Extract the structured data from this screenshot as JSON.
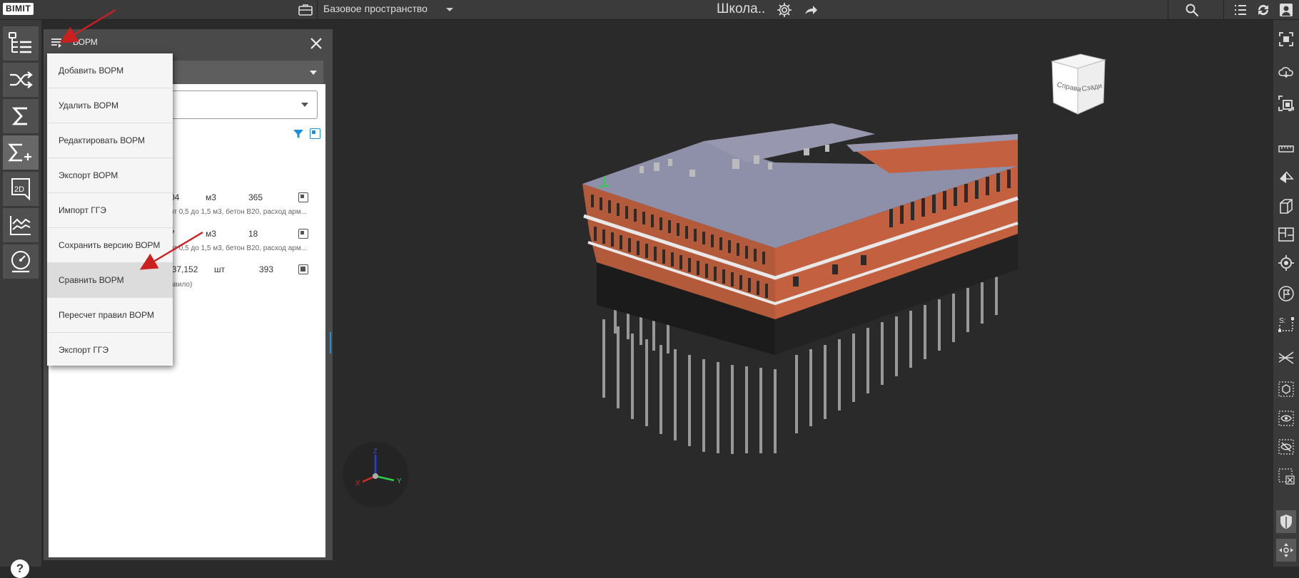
{
  "topbar": {
    "logo": "BIMIT",
    "workspace_label": "Базовое пространство",
    "project_title": "Школа..",
    "icons": [
      "briefcase-icon",
      "chevron-down-icon",
      "gear-icon",
      "share-icon",
      "search-icon",
      "list-icon",
      "sync-icon",
      "user-icon"
    ]
  },
  "left_toolbar": {
    "tools": [
      "model-tree-icon",
      "shuffle-icon",
      "sigma-icon",
      "sigma-plus-icon",
      "2d-icon",
      "chart-line-icon",
      "gauge-icon"
    ],
    "tool_2d_label": "2D",
    "help_label": "?"
  },
  "panel": {
    "title": "ВОРМ",
    "rows": [
      {
        "c1": "04",
        "unit": "м3",
        "count": "365",
        "note": "от 0,5 до 1,5 м3, бетон В20, расход арм..."
      },
      {
        "c1": "7",
        "unit": "м3",
        "count": "18",
        "note": "от 0,5 до 1,5 м3, бетон В20, расход арм..."
      },
      {
        "c1": "137,152",
        "unit": "шт",
        "count": "393",
        "note": "авило)"
      }
    ]
  },
  "menu": {
    "items": [
      "Добавить ВОРМ",
      "Удалить ВОРМ",
      "Редактировать ВОРМ",
      "Экспорт ВОРМ",
      "Импорт ГГЭ",
      "Сохранить версию ВОРМ",
      "Сравнить ВОРМ",
      "Пересчет правил ВОРМ",
      "Экспорт ГГЭ"
    ],
    "highlighted_index": 6
  },
  "viewport": {
    "navcube_left": "Справа",
    "navcube_right": "Сзади",
    "axis_x": "X",
    "axis_y": "Y",
    "axis_z": "Z"
  },
  "right_toolbar": {
    "tools": [
      "fit-view-icon",
      "cloud-icon",
      "focus-icon",
      "ruler-icon",
      "section-plane-icon",
      "section-box-icon",
      "floor-plan-icon",
      "target-icon",
      "flag-icon",
      "dimension-icon",
      "cross-section-icon",
      "cube-outline-icon",
      "eye-icon",
      "eye-off-icon",
      "hide-box-icon",
      "shield-icon",
      "move-icon"
    ]
  },
  "colors": {
    "accent_blue": "#2a8fd0",
    "annotation_red": "#cc1f1f",
    "facade_brick": "#b85a3a"
  }
}
